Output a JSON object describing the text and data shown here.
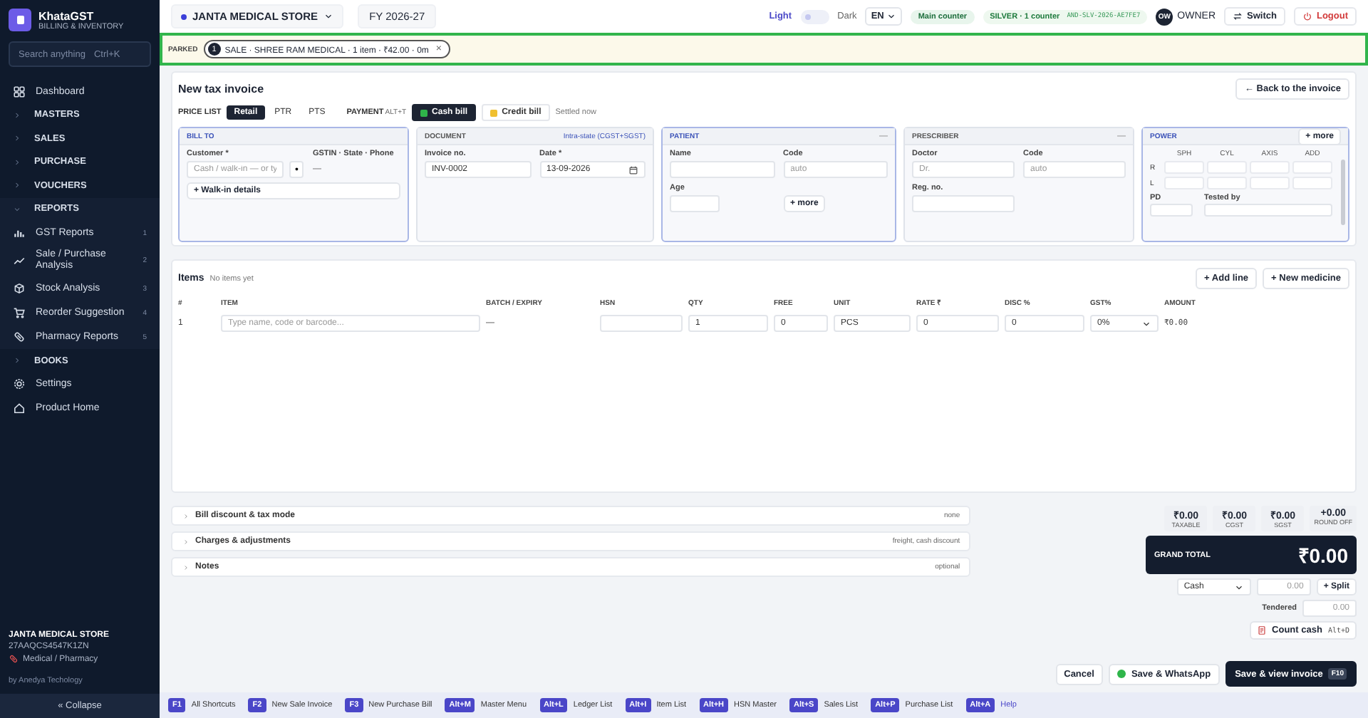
{
  "brand": {
    "name": "KhataGST",
    "tagline": "BILLING & INVENTORY"
  },
  "search": {
    "placeholder": "Search anything",
    "shortcut": "Ctrl+K"
  },
  "nav": [
    {
      "kind": "link",
      "label": "Dashboard"
    },
    {
      "kind": "section",
      "label": "MASTERS",
      "expanded": false
    },
    {
      "kind": "section",
      "label": "SALES",
      "expanded": false
    },
    {
      "kind": "section",
      "label": "PURCHASE",
      "expanded": false
    },
    {
      "kind": "section",
      "label": "VOUCHERS",
      "expanded": false
    },
    {
      "kind": "section",
      "label": "REPORTS",
      "expanded": true,
      "children": [
        {
          "label": "GST Reports",
          "count": "1"
        },
        {
          "label": "Sale / Purchase Analysis",
          "count": "2"
        },
        {
          "label": "Stock Analysis",
          "count": "3"
        },
        {
          "label": "Reorder Suggestion",
          "count": "4"
        },
        {
          "label": "Pharmacy Reports",
          "count": "5"
        }
      ]
    },
    {
      "kind": "section",
      "label": "BOOKS",
      "expanded": false
    },
    {
      "kind": "link",
      "label": "Settings"
    },
    {
      "kind": "link",
      "label": "Product Home"
    }
  ],
  "company": {
    "name": "JANTA MEDICAL STORE",
    "gstin": "27AAQCS4547K1ZN",
    "type": "Medical / Pharmacy",
    "credit": "by Anedya Techology",
    "collapse": "« Collapse"
  },
  "topbar": {
    "store": "JANTA MEDICAL STORE",
    "fy": "FY 2026-27",
    "theme": {
      "light": "Light",
      "dark": "Dark",
      "is_dark": false
    },
    "language": "EN",
    "counter": "Main counter",
    "plan": "SILVER · 1 counter",
    "license": "AND-SLV-2026-AE7FE7",
    "avatar": "OW",
    "user": "OWNER",
    "switch": "Switch",
    "logout": "Logout"
  },
  "parked": {
    "label": "PARKED",
    "count": "1",
    "text": "SALE · SHREE RAM MEDICAL · 1 item · ₹42.00 · 0m",
    "close": "×"
  },
  "invoice": {
    "title": "New tax invoice",
    "back": "← Back to the invoice",
    "price_list": {
      "label": "PRICE LIST",
      "options": [
        {
          "label": "Retail",
          "selected": true
        },
        {
          "label": "PTR",
          "selected": false
        },
        {
          "label": "PTS",
          "selected": false
        }
      ]
    },
    "payment": {
      "label": "PAYMENT",
      "shortcut": "ALT+T",
      "options": [
        {
          "label": "Cash bill",
          "selected": true
        },
        {
          "label": "Credit bill",
          "selected": false
        }
      ],
      "note": "Settled now"
    },
    "bill_to": {
      "title": "BILL TO",
      "highlighted": true,
      "customer_label": "Customer *",
      "customer_placeholder": "Cash / walk-in — or ty",
      "dot": "•",
      "gstin_label": "GSTIN · State · Phone",
      "gstin_value": "—",
      "walkin": "+ Walk-in details"
    },
    "document": {
      "title": "DOCUMENT",
      "highlighted": false,
      "tag": "Intra-state (CGST+SGST)",
      "invoice_label": "Invoice no.",
      "invoice_value": "INV-0002",
      "date_label": "Date *",
      "date_value": "13-09-2026"
    },
    "patient": {
      "title": "PATIENT",
      "highlighted": true,
      "collapse": "—",
      "name_label": "Name",
      "code_label": "Code",
      "code_placeholder": "auto",
      "age_label": "Age",
      "more": "+ more"
    },
    "prescriber": {
      "title": "PRESCRIBER",
      "highlighted": false,
      "collapse": "—",
      "doctor_label": "Doctor",
      "doctor_placeholder": "Dr.",
      "code_label": "Code",
      "code_placeholder": "auto",
      "reg_label": "Reg. no."
    },
    "power": {
      "title": "POWER",
      "highlighted": true,
      "more": "+ more",
      "columns": [
        "SPH",
        "CYL",
        "AXIS",
        "ADD"
      ],
      "rows": [
        "R",
        "L"
      ],
      "pd_label": "PD",
      "tested_label": "Tested by"
    }
  },
  "items": {
    "title": "Items",
    "note": "No items yet",
    "add_line": "+ Add line",
    "new_medicine": "+ New medicine",
    "columns": [
      "#",
      "ITEM",
      "BATCH / EXPIRY",
      "HSN",
      "QTY",
      "FREE",
      "UNIT",
      "RATE ₹",
      "DISC %",
      "GST%",
      "AMOUNT"
    ],
    "row": {
      "index": "1",
      "item_placeholder": "Type name, code or barcode...",
      "batch": "—",
      "qty": "1",
      "free": "0",
      "unit": "PCS",
      "rate": "0",
      "disc": "0",
      "gst": "0%",
      "amount": "₹0.00"
    }
  },
  "sections": [
    {
      "label": "Bill discount & tax mode",
      "hint": "none",
      "expanded": false
    },
    {
      "label": "Charges & adjustments",
      "hint": "freight, cash discount",
      "expanded": false
    },
    {
      "label": "Notes",
      "hint": "optional",
      "expanded": false
    }
  ],
  "totals": [
    {
      "value": "₹0.00",
      "label": "TAXABLE"
    },
    {
      "value": "₹0.00",
      "label": "CGST"
    },
    {
      "value": "₹0.00",
      "label": "SGST"
    },
    {
      "value": "+0.00",
      "label": "ROUND OFF"
    }
  ],
  "grand_total": {
    "label": "GRAND TOTAL",
    "value": "₹0.00"
  },
  "settle": {
    "mode": "Cash",
    "amount_placeholder": "0.00",
    "split": "+ Split",
    "tendered_label": "Tendered",
    "tendered_placeholder": "0.00",
    "count_cash": "Count cash",
    "count_key": "Alt+D"
  },
  "actions": {
    "cancel": "Cancel",
    "whatsapp": "Save & WhatsApp",
    "save": "Save & view invoice",
    "save_key": "F10"
  },
  "shortcuts": [
    {
      "key": "F1",
      "label": "All Shortcuts"
    },
    {
      "key": "F2",
      "label": "New Sale Invoice"
    },
    {
      "key": "F3",
      "label": "New Purchase Bill"
    },
    {
      "key": "Alt+M",
      "label": "Master Menu"
    },
    {
      "key": "Alt+L",
      "label": "Ledger List"
    },
    {
      "key": "Alt+I",
      "label": "Item List"
    },
    {
      "key": "Alt+H",
      "label": "HSN Master"
    },
    {
      "key": "Alt+S",
      "label": "Sales List"
    },
    {
      "key": "Alt+P",
      "label": "Purchase List"
    },
    {
      "key": "Alt+A",
      "label": "Help"
    }
  ]
}
